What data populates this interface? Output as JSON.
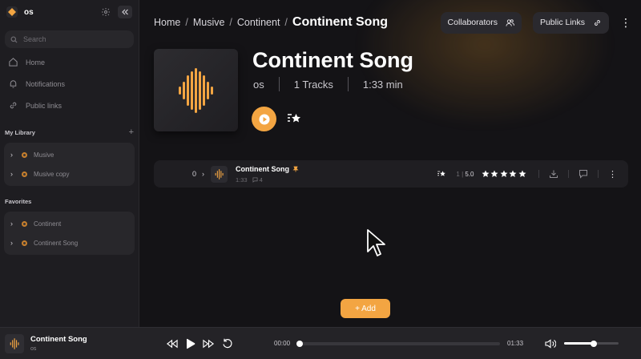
{
  "workspace": {
    "name": "os"
  },
  "search": {
    "placeholder": "Search"
  },
  "nav": [
    {
      "label": "Home",
      "icon": "home-icon"
    },
    {
      "label": "Notifications",
      "icon": "bell-icon"
    },
    {
      "label": "Public links",
      "icon": "link-icon"
    }
  ],
  "library": {
    "title": "My Library",
    "items": [
      {
        "label": "Musive"
      },
      {
        "label": "Musive copy"
      }
    ]
  },
  "favorites": {
    "title": "Favorites",
    "items": [
      {
        "label": "Continent"
      },
      {
        "label": "Continent Song"
      }
    ]
  },
  "breadcrumb": {
    "items": [
      "Home",
      "Musive",
      "Continent"
    ],
    "current": "Continent Song",
    "separator": "/"
  },
  "header": {
    "collaborators_label": "Collaborators",
    "public_links_label": "Public Links"
  },
  "song": {
    "title": "Continent Song",
    "owner": "os",
    "tracks": "1 Tracks",
    "duration": "1:33 min"
  },
  "track": {
    "number": "0",
    "name": "Continent Song",
    "length": "1:33",
    "comments": "4",
    "rating_count": "1",
    "rating_value": "5.0",
    "stars": 5
  },
  "add_button": {
    "label": "+ Add"
  },
  "player": {
    "title": "Continent Song",
    "artist": "os",
    "current_time": "00:00",
    "total_time": "01:33",
    "progress": 0,
    "volume": 0.55
  },
  "colors": {
    "accent": "#f3a542",
    "background": "#141316",
    "sidebar": "#1e1d21"
  }
}
